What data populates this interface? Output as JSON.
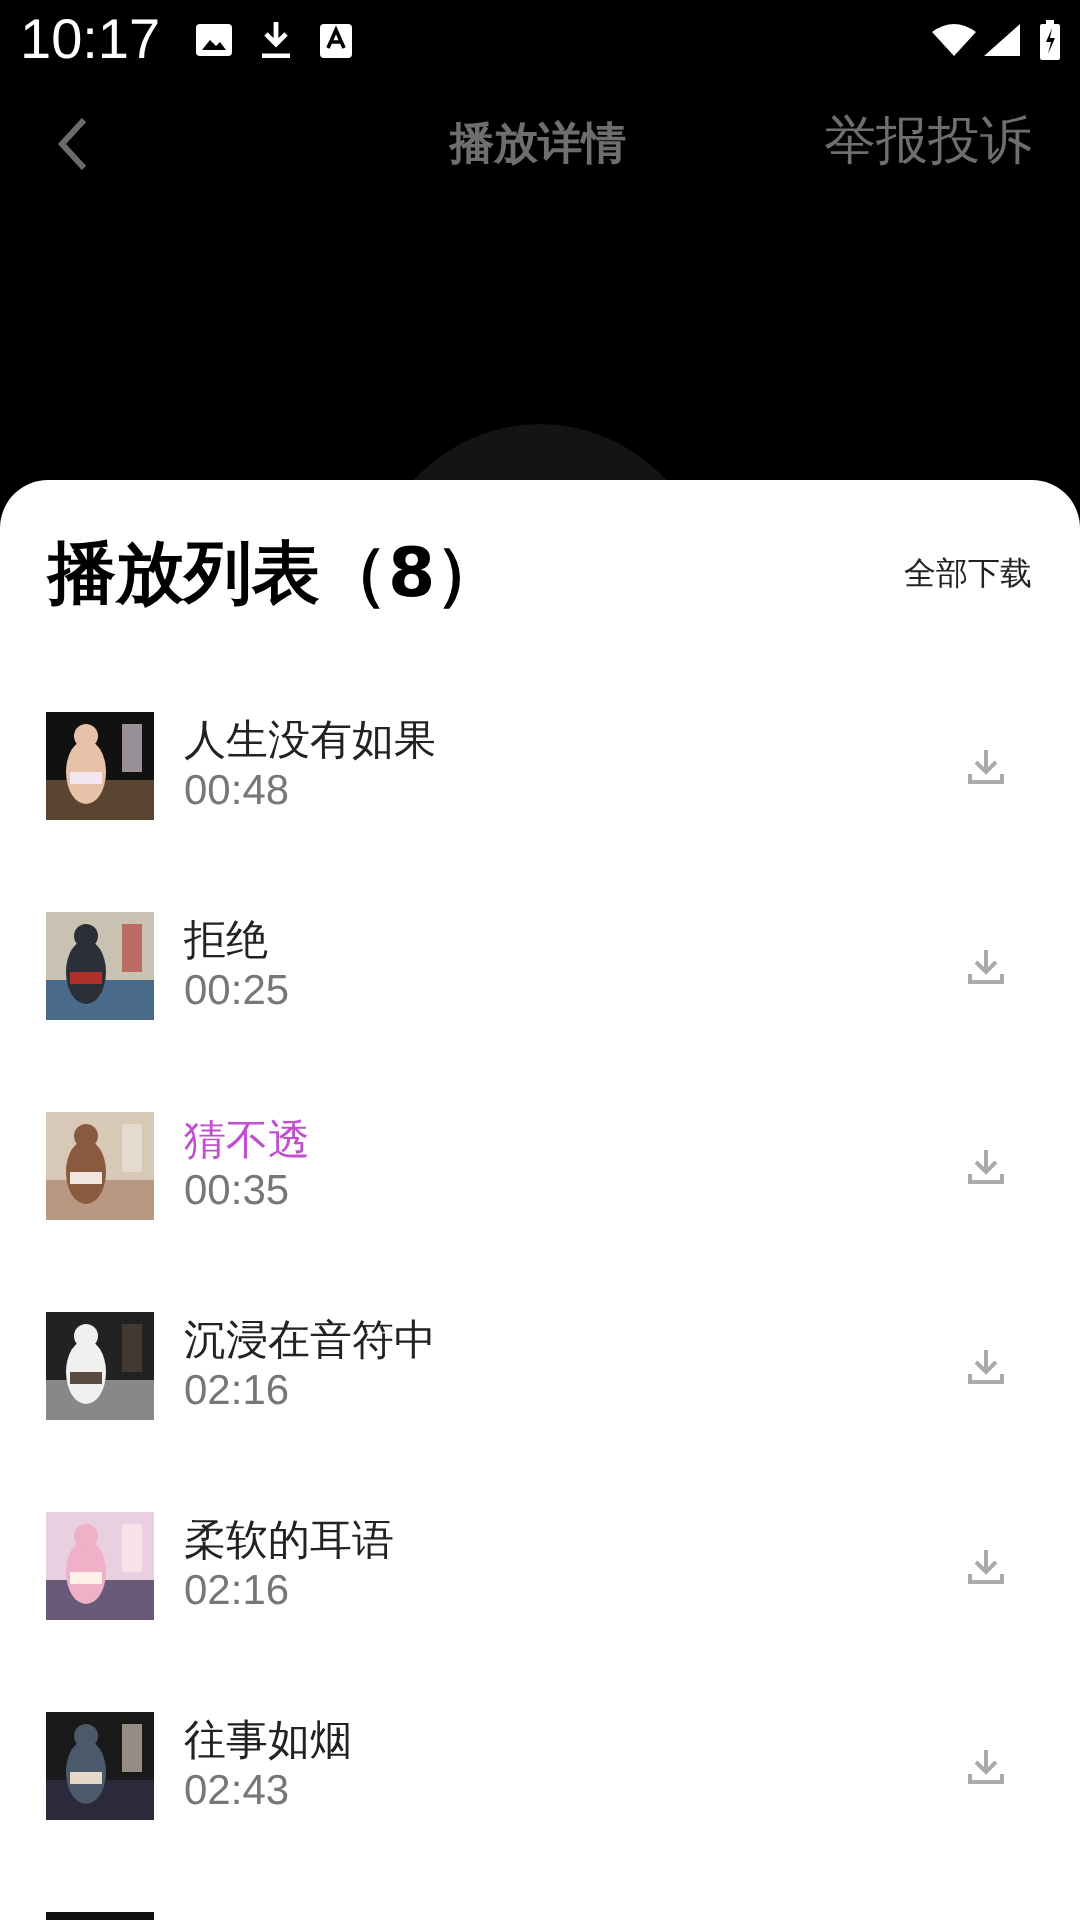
{
  "status_bar": {
    "time": "10:17"
  },
  "header": {
    "title": "播放详情",
    "action": "举报投诉"
  },
  "playlist": {
    "title": "播放列表（8）",
    "download_all": "全部下载",
    "tracks": [
      {
        "title": "人生没有如果",
        "duration": "00:48",
        "selected": false
      },
      {
        "title": "拒绝",
        "duration": "00:25",
        "selected": false
      },
      {
        "title": "猜不透",
        "duration": "00:35",
        "selected": true
      },
      {
        "title": "沉浸在音符中",
        "duration": "02:16",
        "selected": false
      },
      {
        "title": "柔软的耳语",
        "duration": "02:16",
        "selected": false
      },
      {
        "title": "往事如烟",
        "duration": "02:43",
        "selected": false
      }
    ]
  }
}
